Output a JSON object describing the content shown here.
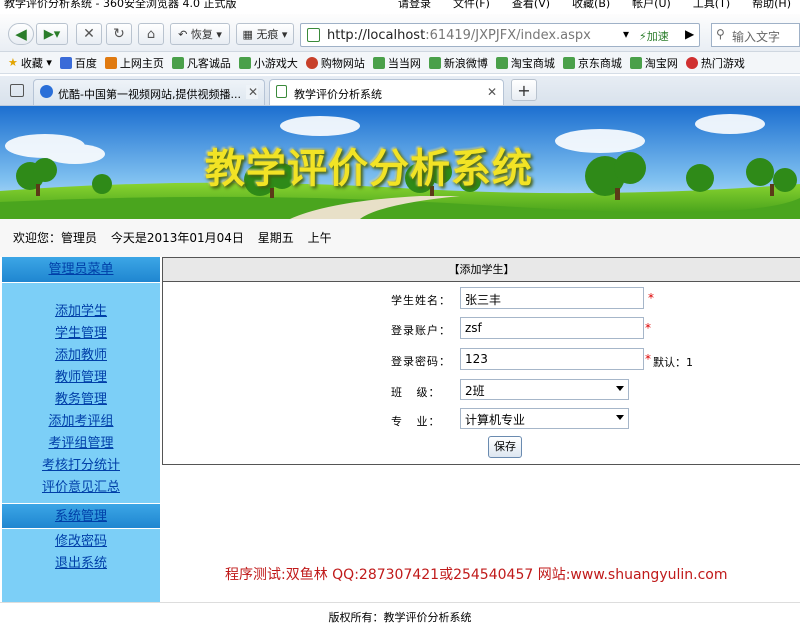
{
  "window": {
    "title": "教学评价分析系统 - 360安全浏览器 4.0 正式版",
    "menu": [
      "请登录",
      "文件(F)",
      "查看(V)",
      "收藏(B)",
      "帐户(U)",
      "工具(T)",
      "帮助(H)"
    ]
  },
  "toolbar": {
    "restore_label": "恢复",
    "incognito_label": "无痕",
    "url_host": "http://localhost",
    "url_rest": ":61419/JXPJFX/index.aspx",
    "accelerate_label": "加速",
    "search_placeholder": "输入文字"
  },
  "favorites": {
    "label": "收藏",
    "items": [
      "百度",
      "上网主页",
      "凡客诚品",
      "小游戏大",
      "购物网站",
      "当当网",
      "新浪微博",
      "淘宝商城",
      "京东商城",
      "淘宝网",
      "热门游戏"
    ]
  },
  "tabs": [
    {
      "label": "优酷-中国第一视频网站,提供视频播...",
      "active": false
    },
    {
      "label": "教学评价分析系统",
      "active": true
    }
  ],
  "banner": {
    "title": "教学评价分析系统"
  },
  "welcome": {
    "greeting": "欢迎您：管理员",
    "date": "今天是2013年01月04日",
    "weekday": "星期五",
    "period": "上午"
  },
  "sidebar": {
    "header": "管理员菜单",
    "items": [
      "添加学生",
      "学生管理",
      "添加教师",
      "教师管理",
      "教务管理",
      "添加考评组",
      "考评组管理",
      "考核打分统计",
      "评价意见汇总"
    ],
    "section2_header": "系统管理",
    "section2_items": [
      "修改密码",
      "退出系统"
    ]
  },
  "form": {
    "title": "【添加学生】",
    "name_label": "学生姓名：",
    "name_value": "张三丰",
    "account_label": "登录账户：",
    "account_value": "zsf",
    "password_label": "登录密码：",
    "password_value": "123",
    "password_hint": "默认：1",
    "class_label": "班   级：",
    "class_value": "2班",
    "major_label": "专   业：",
    "major_value": "计算机专业",
    "required_mark": "*",
    "save_label": "保存"
  },
  "credit": "程序测试:双鱼林 QQ:287307421或254540457 网站:www.shuangyulin.com",
  "footer": "版权所有：教学评价分析系统",
  "colors": {
    "sidebar": "#7ccff7",
    "sidebar_header": "#1f86d0",
    "link": "#003fa8",
    "credit": "#c01a1a"
  }
}
